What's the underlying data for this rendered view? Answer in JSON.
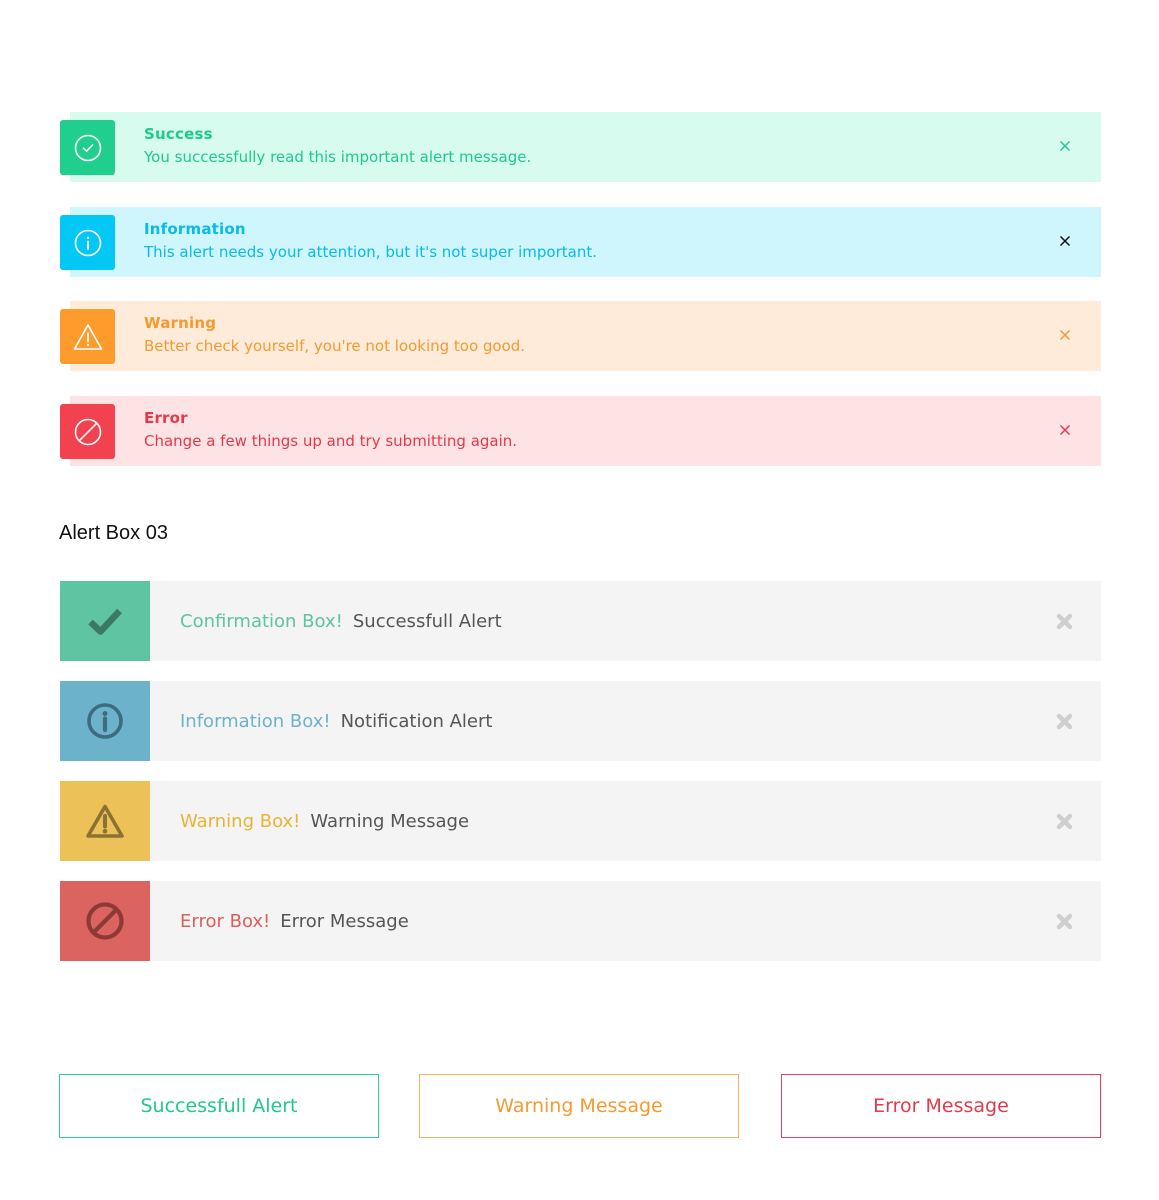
{
  "alert_box_02": [
    {
      "type": "success",
      "title": "Success",
      "message": "You successfully read this important alert message.",
      "icon": "check-circle-icon",
      "close_icon": "close-icon",
      "close_color": "#23c98d"
    },
    {
      "type": "info",
      "title": "Information",
      "message": "This alert needs your attention, but it's not super important.",
      "icon": "info-circle-icon",
      "close_icon": "close-icon",
      "close_color": "#111111"
    },
    {
      "type": "warning",
      "title": "Warning",
      "message": "Better check yourself, you're not looking too good.",
      "icon": "warning-triangle-icon",
      "close_icon": "close-icon",
      "close_color": "#f59a30"
    },
    {
      "type": "error",
      "title": "Error",
      "message": "Change a few things up and try submitting again.",
      "icon": "prohibited-icon",
      "close_icon": "close-icon",
      "close_color": "#e23a4a"
    }
  ],
  "alert_box_03": {
    "title": "Alert Box 03",
    "items": [
      {
        "type": "success",
        "lead": "Confirmation Box!",
        "body": "Successfull Alert",
        "icon": "checkmark-icon",
        "close_icon": "close-icon"
      },
      {
        "type": "info",
        "lead": "Information Box!",
        "body": "Notification Alert",
        "icon": "info-circle-icon",
        "close_icon": "close-icon"
      },
      {
        "type": "warning",
        "lead": "Warning Box!",
        "body": "Warning Message",
        "icon": "warning-triangle-icon",
        "close_icon": "close-icon"
      },
      {
        "type": "error",
        "lead": "Error Box!",
        "body": "Error Message",
        "icon": "prohibited-icon",
        "close_icon": "close-icon"
      }
    ]
  },
  "outline_buttons": [
    {
      "type": "success",
      "label": "Successfull Alert"
    },
    {
      "type": "warning",
      "label": "Warning Message"
    },
    {
      "type": "error",
      "label": "Error Message"
    }
  ],
  "colors": {
    "success": "#20cf8e",
    "info": "#03c8f5",
    "warning": "#fe9b2d",
    "error": "#f2424f",
    "success_muted": "#5ec4a1",
    "info_muted": "#6db2cb",
    "warning_muted": "#ebc158",
    "error_muted": "#dc6460"
  }
}
